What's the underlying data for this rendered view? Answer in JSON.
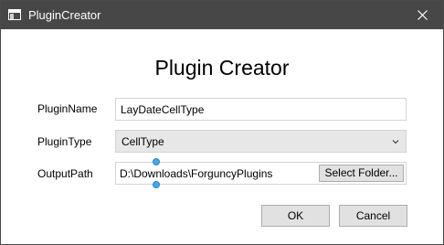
{
  "window": {
    "title": "PluginCreator",
    "icon": "app-window-icon",
    "close_icon": "close-icon"
  },
  "heading": "Plugin Creator",
  "form": {
    "plugin_name": {
      "label": "PluginName",
      "value": "LayDateCellType"
    },
    "plugin_type": {
      "label": "PluginType",
      "value": "CellType",
      "icon": "chevron-down-icon"
    },
    "output_path": {
      "label": "OutputPath",
      "value": "D:\\Downloads\\ForguncyPlugins",
      "button_label": "Select Folder..."
    }
  },
  "buttons": {
    "ok_label": "OK",
    "cancel_label": "Cancel"
  },
  "colors": {
    "titlebar": "#474747",
    "border": "#d4d4d4",
    "button_bg": "#e1e1e1",
    "caret_handle": "#45a7e6"
  }
}
